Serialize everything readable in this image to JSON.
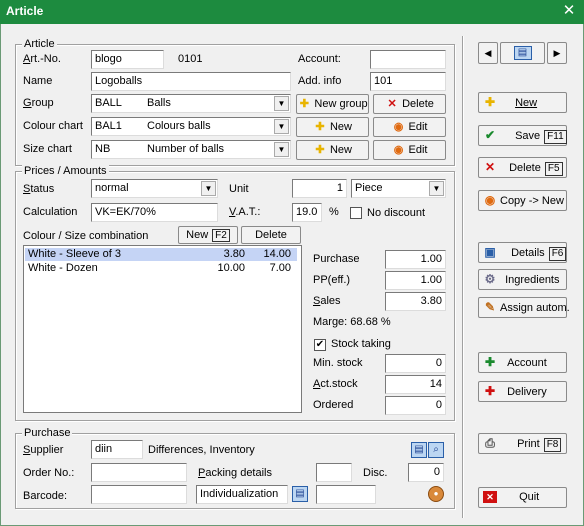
{
  "window": {
    "title": "Article",
    "close": "✕"
  },
  "article": {
    "legend": "Article",
    "artno_label": "Art.-No.",
    "artno_value": "blogo",
    "artno_suffix": "0101",
    "account_label": "Account:",
    "account_value": "",
    "name_label": "Name",
    "name_value": "Logoballs",
    "addinfo_label": "Add. info",
    "addinfo_value": "101",
    "group_label": "Group",
    "group_code": "BALL",
    "group_name": "Balls",
    "new_group_label": "New group",
    "delete_label": "Delete",
    "colour_label": "Colour chart",
    "colour_code": "BAL1",
    "colour_name": "Colours balls",
    "size_label": "Size chart",
    "size_code": "NB",
    "size_name": "Number of balls",
    "new_label": "New",
    "edit_label": "Edit"
  },
  "prices": {
    "legend": "Prices / Amounts",
    "status_label": "Status",
    "status_value": "normal",
    "unit_label": "Unit",
    "unit_qty": "1",
    "unit_value": "Piece",
    "calc_label": "Calculation",
    "calc_value": "VK=EK/70%",
    "vat_label": "V.A.T.:",
    "vat_value": "19.0",
    "vat_unit": "%",
    "nodiscount_label": "No discount",
    "nodiscount_checked": false,
    "combo_label": "Colour / Size combination",
    "combo_new": "New",
    "combo_new_key": "F2",
    "combo_delete": "Delete",
    "combinations": [
      {
        "name": "White - Sleeve of 3",
        "purchase": "3.80",
        "sales": "14.00",
        "selected": true
      },
      {
        "name": "White - Dozen",
        "purchase": "10.00",
        "sales": "7.00",
        "selected": false
      }
    ],
    "purchase_label": "Purchase",
    "purchase_value": "1.00",
    "pp_label": "PP(eff.)",
    "pp_value": "1.00",
    "sales_label": "Sales",
    "sales_value": "3.80",
    "margin_text": "Marge: 68.68 %",
    "stock_label": "Stock taking",
    "stock_checked": true,
    "check_mark": "✔",
    "minstock_label": "Min. stock",
    "minstock_value": "0",
    "actstock_label": "Act.stock",
    "actstock_value": "14",
    "ordered_label": "Ordered",
    "ordered_value": "0"
  },
  "purchase": {
    "legend": "Purchase",
    "supplier_label": "Supplier",
    "supplier_value": "diin",
    "supplier_name": "Differences, Inventory",
    "orderno_label": "Order No.:",
    "orderno_value": "",
    "packing_label": "Packing details",
    "packing_value": "",
    "disc_label": "Disc.",
    "disc_value": "0",
    "barcode_label": "Barcode:",
    "barcode_value": "",
    "individ_value": "Individualization",
    "extra_value": ""
  },
  "sidebar": {
    "nav_prev": "◀",
    "nav_next": "▶",
    "new": "New",
    "save": "Save",
    "save_key": "F11",
    "delete": "Delete",
    "delete_key": "F5",
    "copy": "Copy -> New",
    "details": "Details",
    "details_key": "F6",
    "ingredients": "Ingredients",
    "assign": "Assign autom.",
    "account": "Account",
    "delivery": "Delivery",
    "print": "Print",
    "print_key": "F8",
    "quit": "Quit"
  },
  "colors": {
    "title_bar": "#1d8b3f",
    "selection": "#c5d4f5",
    "new_icon": "#e8b400",
    "ok_icon": "#1a8a2e",
    "delete_icon": "#d01010",
    "edit_icon": "#e06a10"
  }
}
